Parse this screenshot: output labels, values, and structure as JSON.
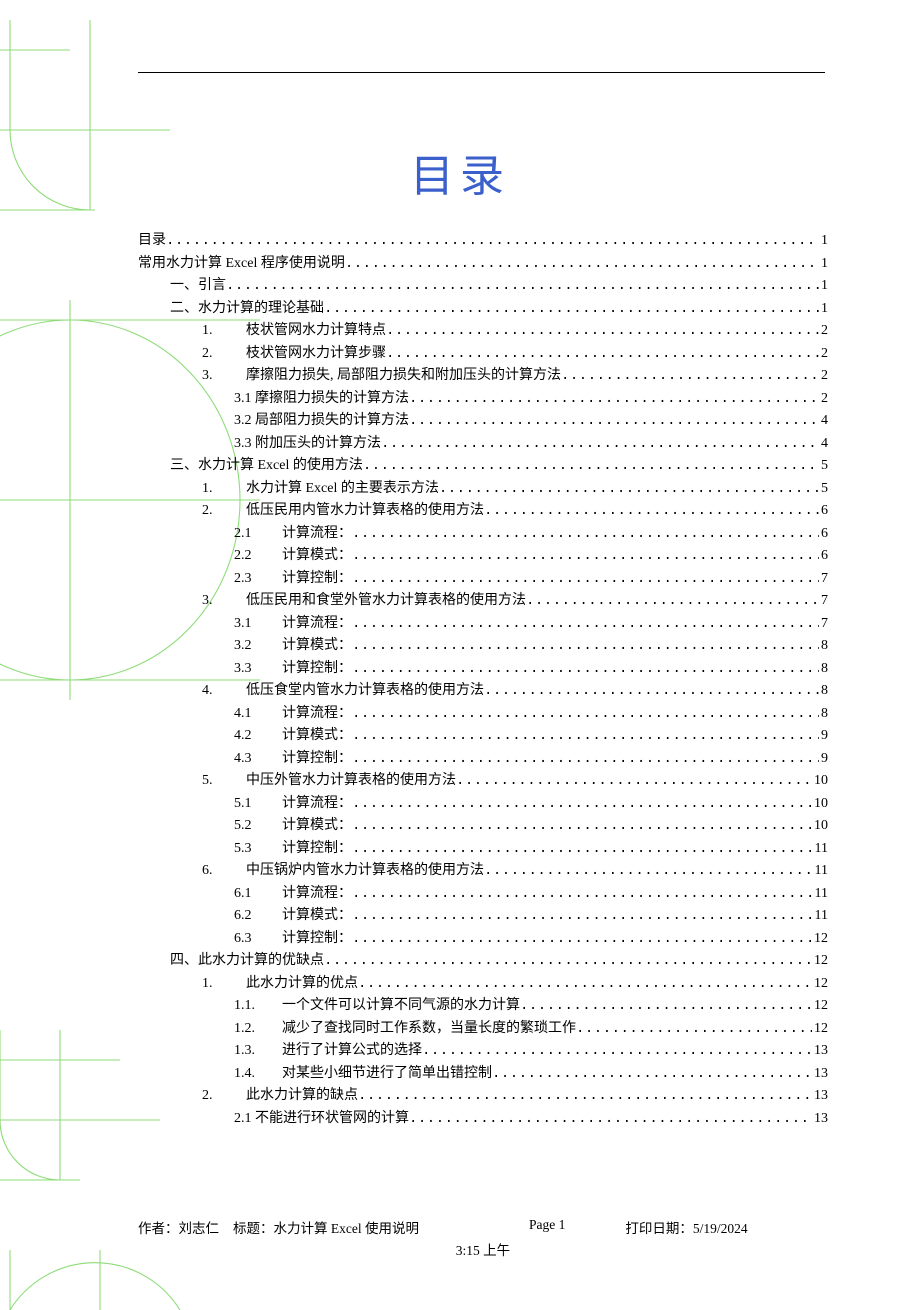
{
  "title": "目录",
  "toc": [
    {
      "indent": 0,
      "numLabel": "",
      "title": "目录",
      "page": "1"
    },
    {
      "indent": 0,
      "numLabel": "",
      "title": "常用水力计算 Excel 程序使用说明",
      "page": "1"
    },
    {
      "indent": 1,
      "numLabel": "",
      "title": "一、引言",
      "page": "1"
    },
    {
      "indent": 1,
      "numLabel": "",
      "title": "二、水力计算的理论基础",
      "page": "1"
    },
    {
      "indent": 2,
      "numLabel": "1.",
      "title": "枝状管网水力计算特点",
      "page": "2"
    },
    {
      "indent": 2,
      "numLabel": "2.",
      "title": "枝状管网水力计算步骤",
      "page": "2"
    },
    {
      "indent": 2,
      "numLabel": "3.",
      "title": "摩擦阻力损失, 局部阻力损失和附加压头的计算方法",
      "page": "2"
    },
    {
      "indent": 3,
      "numLabel": "3.1",
      "title": "摩擦阻力损失的计算方法",
      "page": "2",
      "join": true
    },
    {
      "indent": 3,
      "numLabel": "3.2",
      "title": "局部阻力损失的计算方法",
      "page": "4",
      "join": true
    },
    {
      "indent": 3,
      "numLabel": "3.3",
      "title": "附加压头的计算方法",
      "page": "4",
      "join": true
    },
    {
      "indent": 1,
      "numLabel": "",
      "title": "三、水力计算 Excel 的使用方法",
      "page": "5"
    },
    {
      "indent": 2,
      "numLabel": "1.",
      "title": "水力计算 Excel 的主要表示方法",
      "page": "5"
    },
    {
      "indent": 2,
      "numLabel": "2.",
      "title": "低压民用内管水力计算表格的使用方法",
      "page": "6"
    },
    {
      "indent": 3,
      "numLabel": "2.1",
      "title": "计算流程：",
      "page": "6"
    },
    {
      "indent": 3,
      "numLabel": "2.2",
      "title": "计算模式：",
      "page": "6"
    },
    {
      "indent": 3,
      "numLabel": "2.3",
      "title": "计算控制：",
      "page": "7"
    },
    {
      "indent": 2,
      "numLabel": "3.",
      "title": "低压民用和食堂外管水力计算表格的使用方法",
      "page": "7"
    },
    {
      "indent": 3,
      "numLabel": "3.1",
      "title": "计算流程：",
      "page": "7"
    },
    {
      "indent": 3,
      "numLabel": "3.2",
      "title": "计算模式：",
      "page": "8"
    },
    {
      "indent": 3,
      "numLabel": "3.3",
      "title": "计算控制：",
      "page": "8"
    },
    {
      "indent": 2,
      "numLabel": "4.",
      "title": "低压食堂内管水力计算表格的使用方法",
      "page": "8"
    },
    {
      "indent": 3,
      "numLabel": "4.1",
      "title": "计算流程：",
      "page": "8"
    },
    {
      "indent": 3,
      "numLabel": "4.2",
      "title": "计算模式：",
      "page": "9"
    },
    {
      "indent": 3,
      "numLabel": "4.3",
      "title": "计算控制：",
      "page": "9"
    },
    {
      "indent": 2,
      "numLabel": "5.",
      "title": "中压外管水力计算表格的使用方法",
      "page": "10"
    },
    {
      "indent": 3,
      "numLabel": "5.1",
      "title": "计算流程：",
      "page": "10"
    },
    {
      "indent": 3,
      "numLabel": "5.2",
      "title": "计算模式：",
      "page": "10"
    },
    {
      "indent": 3,
      "numLabel": "5.3",
      "title": "计算控制：",
      "page": "11"
    },
    {
      "indent": 2,
      "numLabel": "6.",
      "title": "中压锅炉内管水力计算表格的使用方法",
      "page": "11"
    },
    {
      "indent": 3,
      "numLabel": "6.1",
      "title": "计算流程：",
      "page": "11"
    },
    {
      "indent": 3,
      "numLabel": "6.2",
      "title": "计算模式：",
      "page": "11"
    },
    {
      "indent": 3,
      "numLabel": "6.3",
      "title": "计算控制：",
      "page": "12"
    },
    {
      "indent": 1,
      "numLabel": "",
      "title": "四、此水力计算的优缺点",
      "page": "12"
    },
    {
      "indent": 2,
      "numLabel": "1.",
      "title": "此水力计算的优点",
      "page": "12"
    },
    {
      "indent": 3,
      "numLabel": "1.1.",
      "title": "一个文件可以计算不同气源的水力计算",
      "page": "12"
    },
    {
      "indent": 3,
      "numLabel": "1.2.",
      "title": "减少了查找同时工作系数，当量长度的繁琐工作",
      "page": "12"
    },
    {
      "indent": 3,
      "numLabel": "1.3.",
      "title": "进行了计算公式的选择",
      "page": "13"
    },
    {
      "indent": 3,
      "numLabel": "1.4.",
      "title": "对某些小细节进行了简单出错控制",
      "page": "13"
    },
    {
      "indent": 2,
      "numLabel": "2.",
      "title": "此水力计算的缺点",
      "page": "13"
    },
    {
      "indent": 3,
      "numLabel": "2.1",
      "title": "不能进行环状管网的计算",
      "page": "13",
      "join": true
    }
  ],
  "footer": {
    "author_label": "作者：",
    "author": "刘志仁",
    "title_label": "标题：",
    "title": "水力计算 Excel 使用说明",
    "page_label": "Page",
    "page_num": "1",
    "date_label": "打印日期：",
    "date": "5/19/2024",
    "time": "3:15 上午"
  }
}
